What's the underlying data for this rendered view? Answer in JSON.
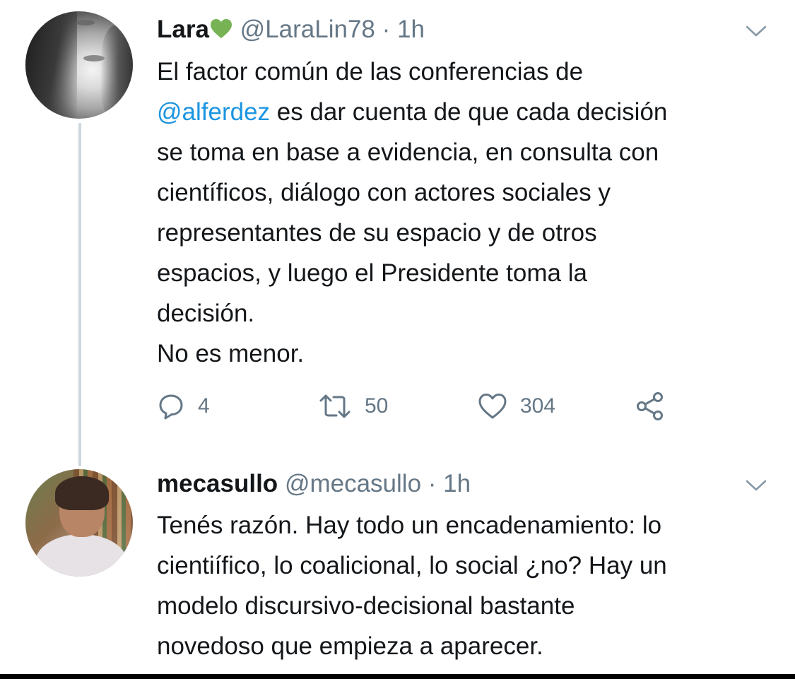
{
  "tweets": [
    {
      "name": "Lara",
      "name_emoji": "green-heart-icon",
      "handle": "@LaraLin78",
      "separator": "·",
      "time": "1h",
      "text_lines": [
        {
          "mention": "",
          "text": "El factor común de las conferencias de"
        },
        {
          "mention": "@alferdez",
          "text": " es dar cuenta de que cada decisión"
        },
        {
          "mention": "",
          "text": "se toma en base a evidencia, en consulta con"
        },
        {
          "mention": "",
          "text": "científicos, diálogo con actores sociales y"
        },
        {
          "mention": "",
          "text": "representantes de su espacio y de otros"
        },
        {
          "mention": "",
          "text": "espacios, y luego el Presidente toma la"
        },
        {
          "mention": "",
          "text": "decisión."
        },
        {
          "mention": "",
          "text": "No es menor."
        }
      ],
      "actions": {
        "reply_icon": "reply-icon",
        "reply_count": "4",
        "retweet_icon": "retweet-icon",
        "retweet_count": "50",
        "like_icon": "heart-icon",
        "like_count": "304",
        "share_icon": "share-icon"
      }
    },
    {
      "name": "mecasullo",
      "handle": "@mecasullo",
      "separator": "·",
      "time": "1h",
      "text_lines": [
        "Tenés razón. Hay todo un encadenamiento: lo",
        "cientiífico, lo coalicional, lo social ¿no? Hay un",
        "modelo discursivo-decisional bastante",
        "novedoso que empieza a aparecer."
      ]
    }
  ],
  "colors": {
    "text": "#14171a",
    "secondary": "#657786",
    "mention": "#1b95e0",
    "thread_line": "#ccd6dd",
    "heart_emoji": "#77b255"
  }
}
